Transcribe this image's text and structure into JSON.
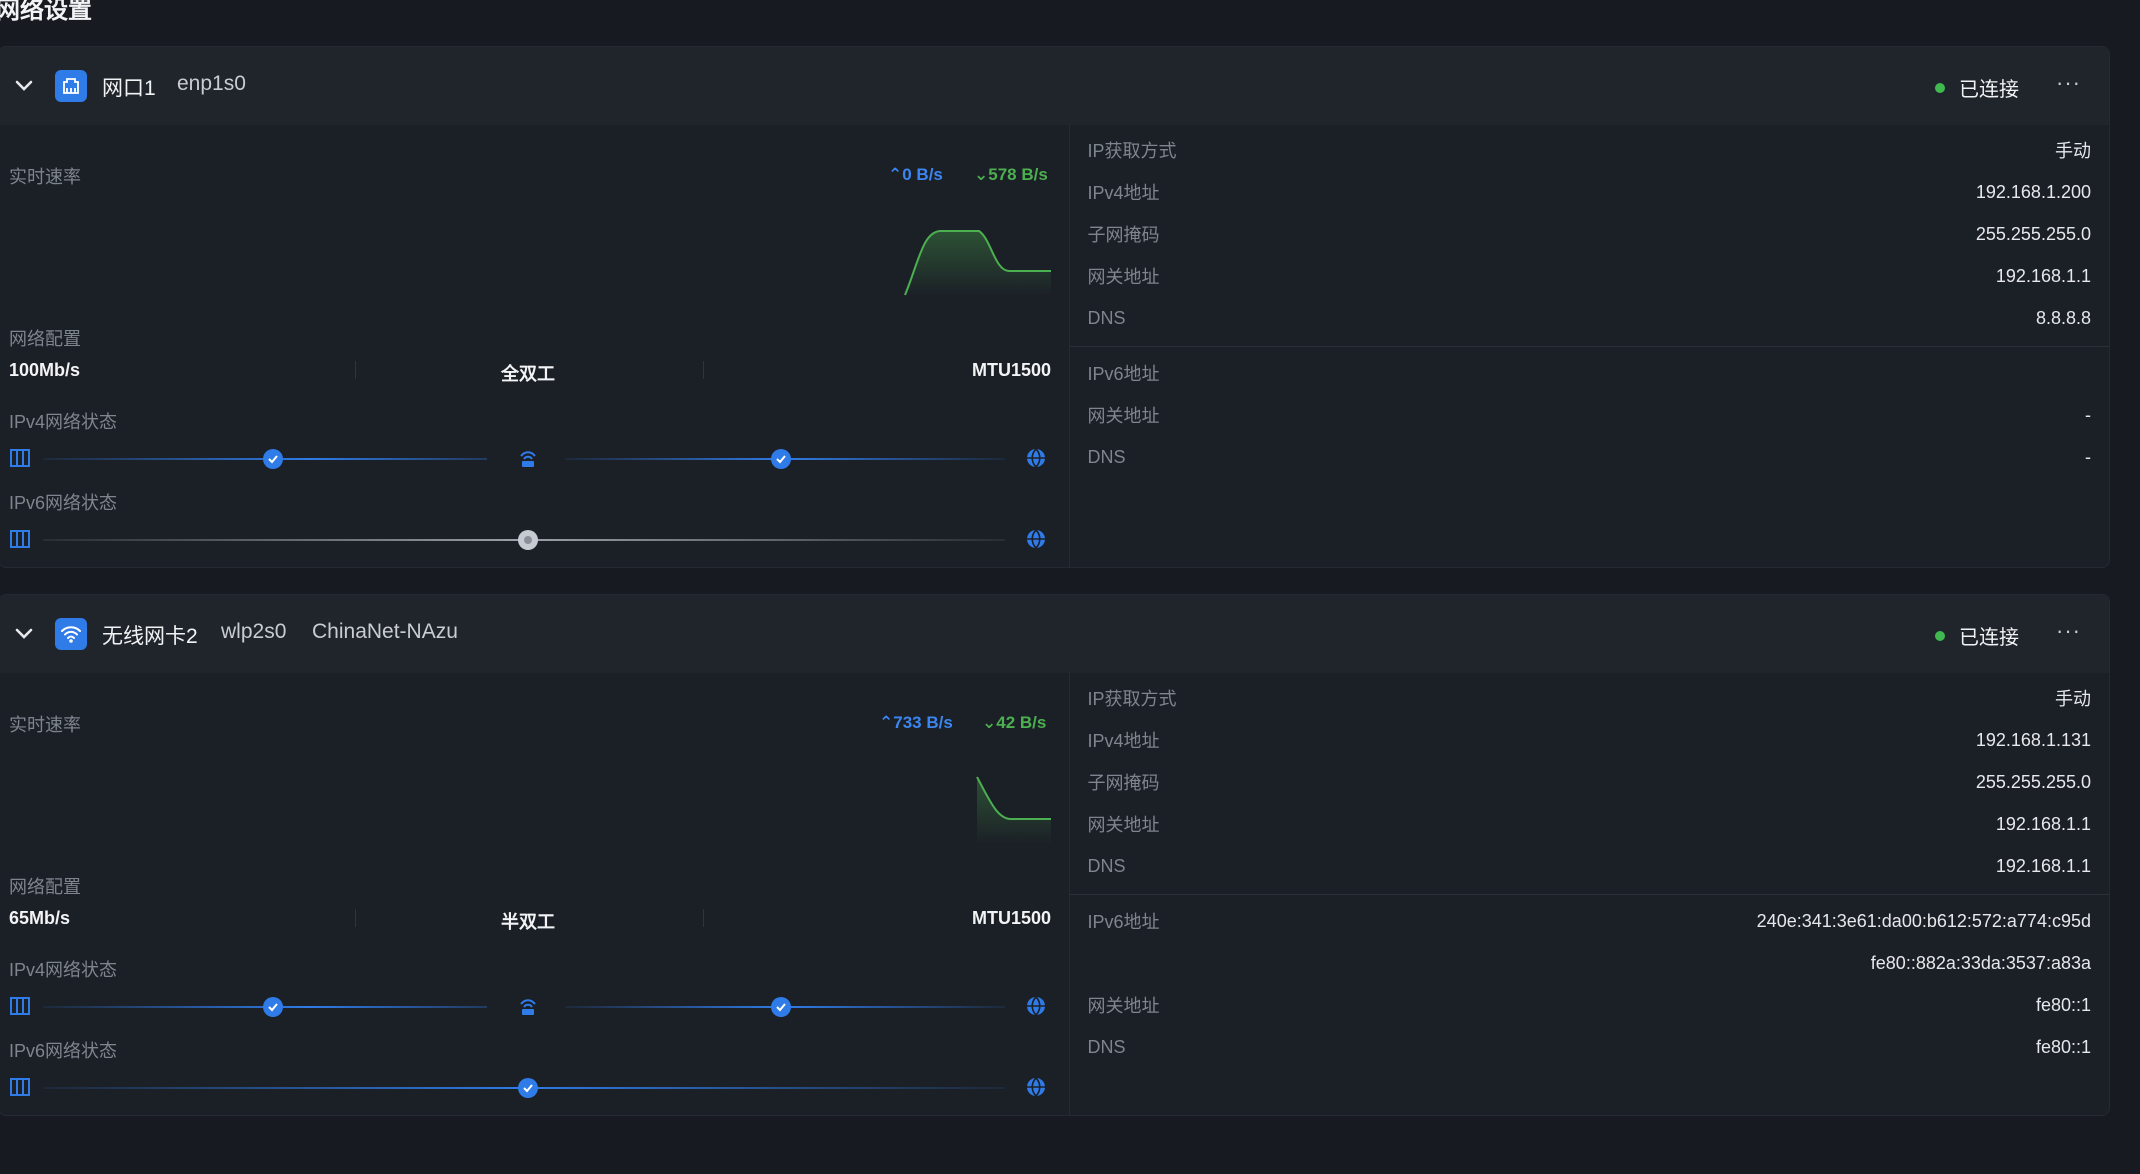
{
  "page": {
    "title": "网络设置"
  },
  "colors": {
    "accent": "#2f7be8",
    "up": "#3b86f0",
    "down": "#4caf50",
    "connected": "#3fb950"
  },
  "cards": [
    {
      "name": "网口1",
      "device": "enp1s0",
      "ssid": "",
      "icon": "ethernet-port-icon",
      "status": "已连接",
      "more": "···",
      "speed_label": "实时速率",
      "upload": "0 B/s",
      "download": "578 B/s",
      "net_config_label": "网络配置",
      "link_speed": "100Mb/s",
      "duplex": "全双工",
      "mtu": "MTU1500",
      "ipv4_status_label": "IPv4网络状态",
      "ipv6_status_label": "IPv6网络状态",
      "ipv4_status_nodes": [
        "ok",
        "router",
        "ok"
      ],
      "ipv6_status_state": "off",
      "details_v4": [
        {
          "k": "IP获取方式",
          "v": "手动"
        },
        {
          "k": "IPv4地址",
          "v": "192.168.1.200"
        },
        {
          "k": "子网掩码",
          "v": "255.255.255.0"
        },
        {
          "k": "网关地址",
          "v": "192.168.1.1"
        },
        {
          "k": "DNS",
          "v": "8.8.8.8"
        }
      ],
      "details_v6": [
        {
          "k": "IPv6地址",
          "v": ""
        },
        {
          "k": "网关地址",
          "v": "-"
        },
        {
          "k": "DNS",
          "v": "-"
        }
      ]
    },
    {
      "name": "无线网卡2",
      "device": "wlp2s0",
      "ssid": "ChinaNet-NAzu",
      "icon": "wifi-icon",
      "status": "已连接",
      "more": "···",
      "speed_label": "实时速率",
      "upload": "733 B/s",
      "download": "42 B/s",
      "net_config_label": "网络配置",
      "link_speed": "65Mb/s",
      "duplex": "半双工",
      "mtu": "MTU1500",
      "ipv4_status_label": "IPv4网络状态",
      "ipv6_status_label": "IPv6网络状态",
      "ipv4_status_nodes": [
        "ok",
        "router",
        "ok"
      ],
      "ipv6_status_state": "ok",
      "details_v4": [
        {
          "k": "IP获取方式",
          "v": "手动"
        },
        {
          "k": "IPv4地址",
          "v": "192.168.1.131"
        },
        {
          "k": "子网掩码",
          "v": "255.255.255.0"
        },
        {
          "k": "网关地址",
          "v": "192.168.1.1"
        },
        {
          "k": "DNS",
          "v": "192.168.1.1"
        }
      ],
      "details_v6": [
        {
          "k": "IPv6地址",
          "v": "240e:341:3e61:da00:b612:572:a774:c95d"
        },
        {
          "k": "",
          "v": "fe80::882a:33da:3537:a83a"
        },
        {
          "k": "网关地址",
          "v": "fe80::1"
        },
        {
          "k": "DNS",
          "v": "fe80::1"
        }
      ]
    }
  ]
}
